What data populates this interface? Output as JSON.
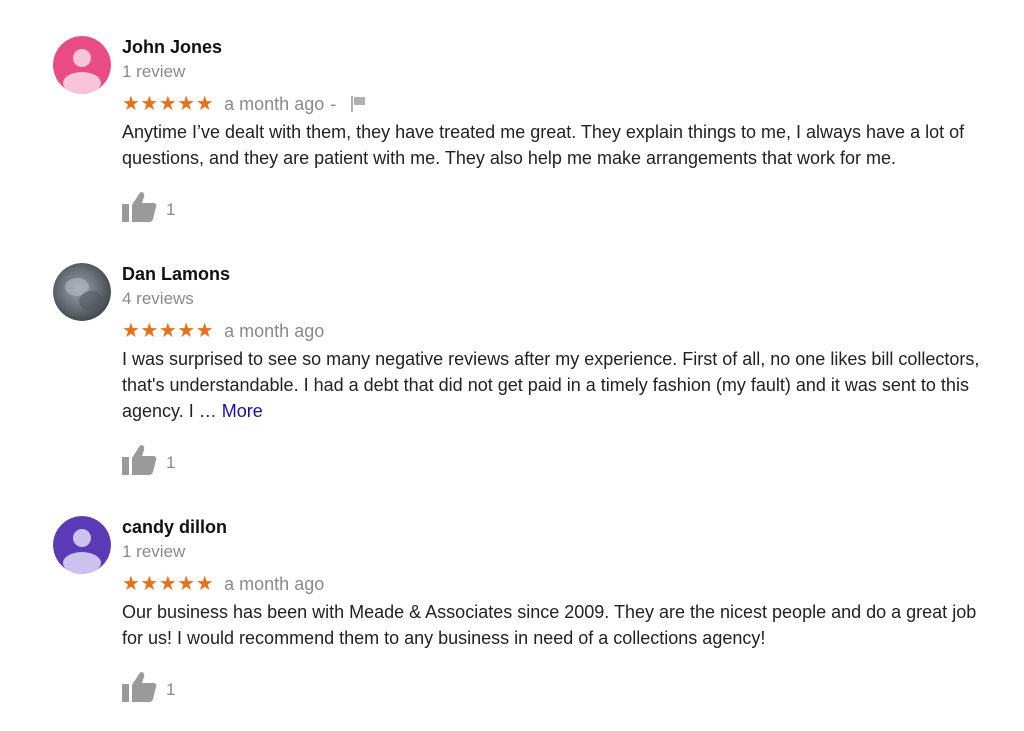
{
  "reviews": [
    {
      "author": "John Jones",
      "review_count": "1 review",
      "stars": "★★★★★",
      "rating": 5,
      "date": "a month ago",
      "separator": "-",
      "text": "Anytime I’ve dealt with them, they have treated me great. They explain things to me, I always have a lot of questions, and they are patient with me. They also help me make arrangements that work for me.",
      "likes": "1",
      "avatar_color": "#e94b85",
      "avatar_icon": "person-icon"
    },
    {
      "author": "Dan Lamons",
      "review_count": "4 reviews",
      "stars": "★★★★★",
      "rating": 5,
      "date": "a month ago",
      "text": "I was surprised to see so many negative reviews after my experience. First of all, no one likes bill collectors, that's understandable. I had a debt that did not get paid in a timely fashion (my fault) and it was sent to this agency. I … ",
      "more_label": "More",
      "likes": "1",
      "avatar_color": "#6b7078",
      "avatar_icon": "profile-photo"
    },
    {
      "author": "candy dillon",
      "review_count": "1 review",
      "stars": "★★★★★",
      "rating": 5,
      "date": "a month ago",
      "text": "Our business has been with Meade & Associates since 2009. They are the nicest people and do a great job for us! I would recommend them to any business in need of a collections agency!",
      "likes": "1",
      "avatar_color": "#5b3ab8",
      "avatar_icon": "person-icon"
    }
  ],
  "colors": {
    "star": "#e7711b",
    "muted": "#8a8a8a",
    "link": "#1a0dab"
  }
}
